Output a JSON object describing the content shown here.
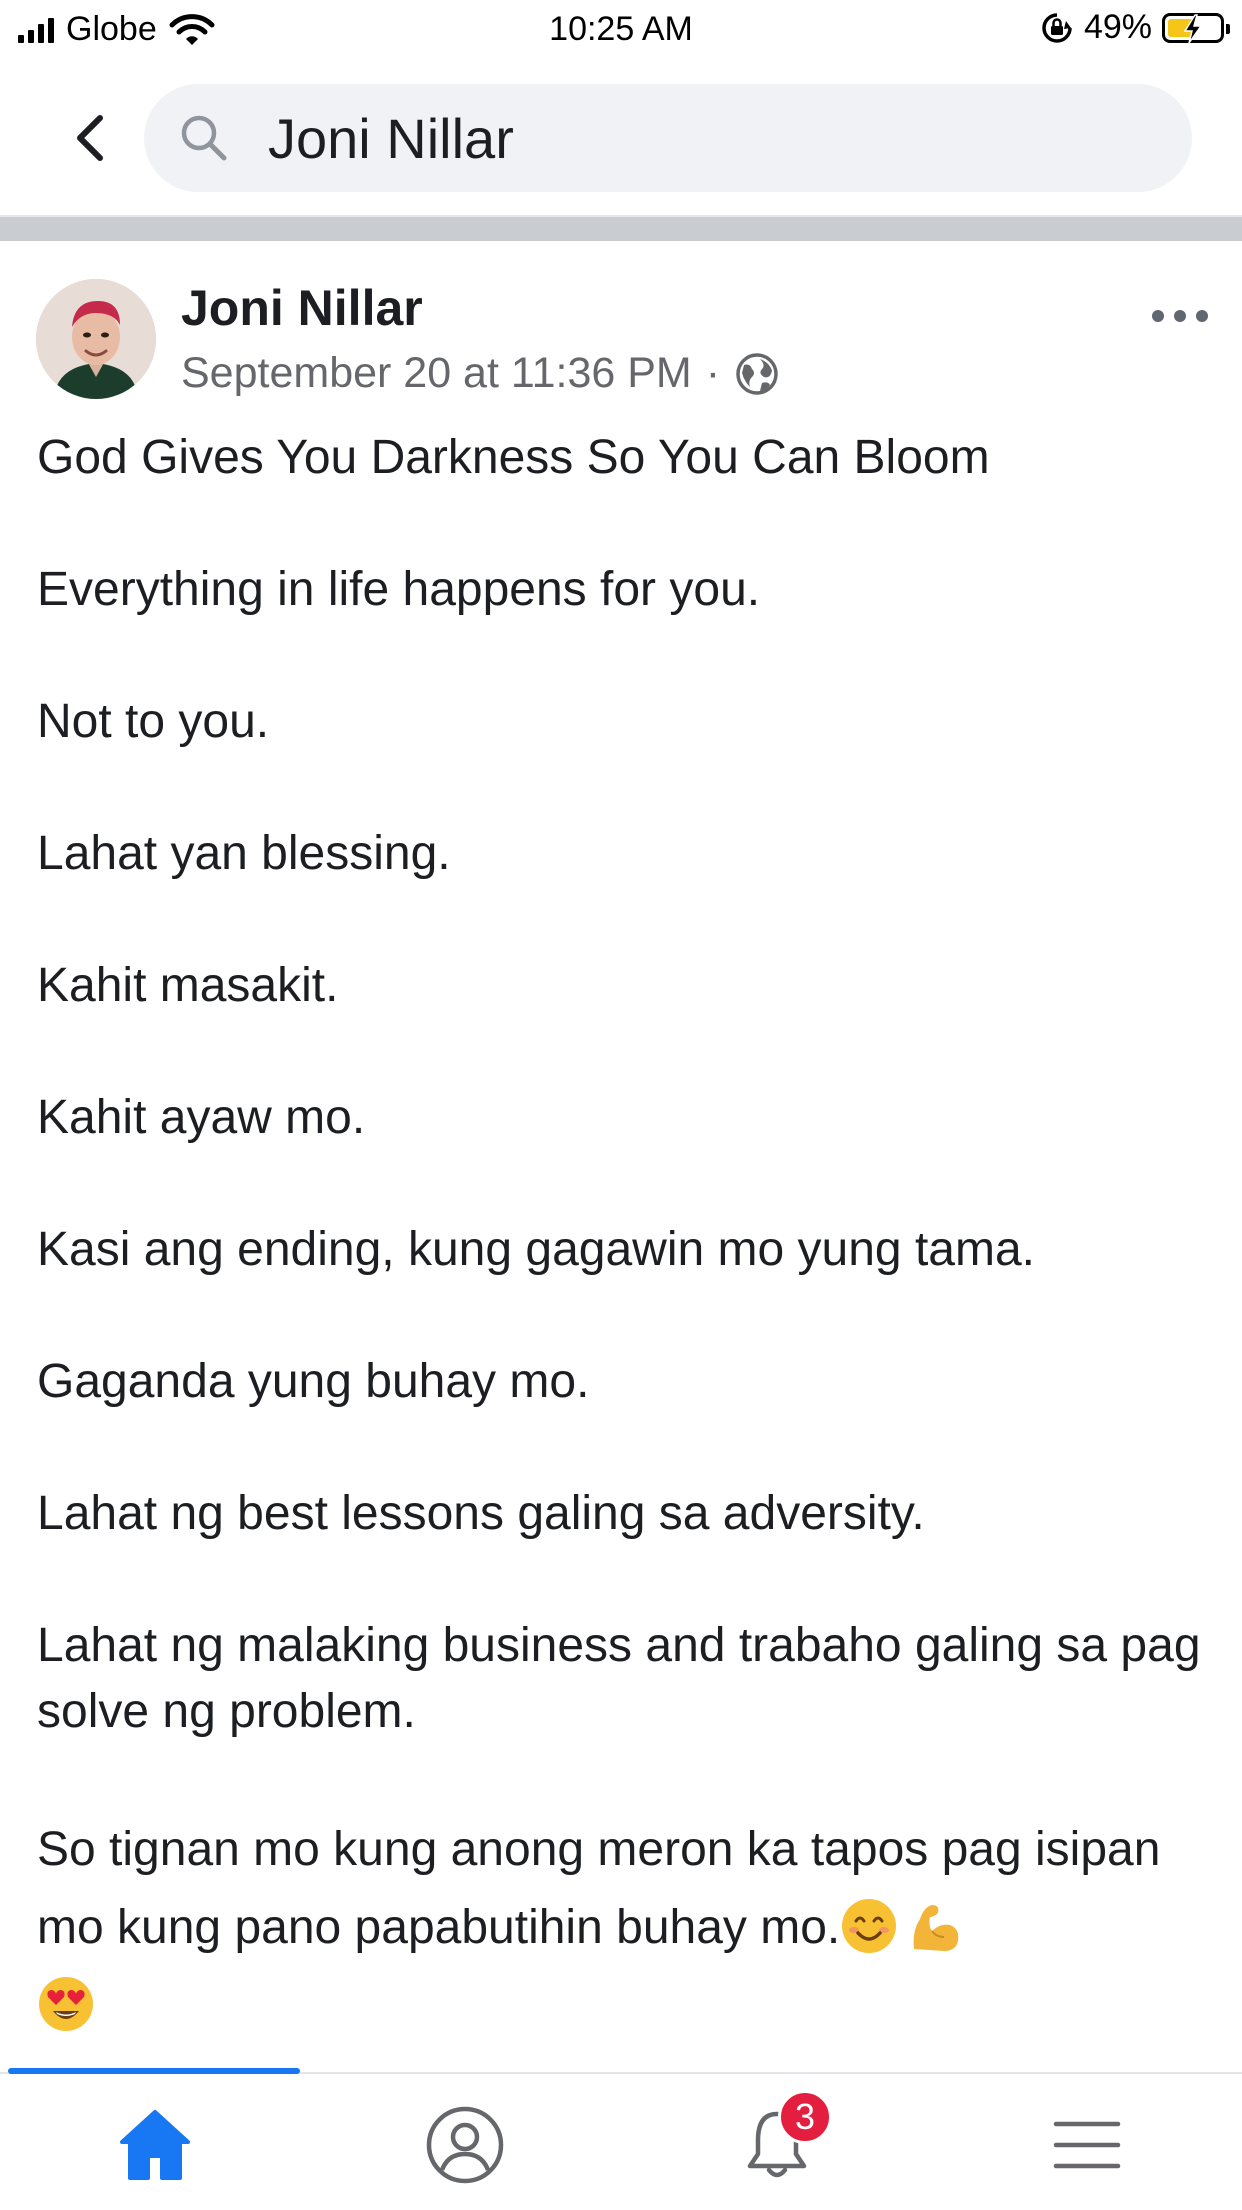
{
  "status_bar": {
    "carrier": "Globe",
    "time": "10:25 AM",
    "battery_percent": "49%",
    "battery_level": 0.49,
    "icons": [
      "signal-icon",
      "wifi-icon",
      "orientation-lock-icon",
      "battery-charging-icon"
    ]
  },
  "search": {
    "query": "Joni Nillar",
    "icons": [
      "back-icon",
      "search-icon"
    ]
  },
  "post": {
    "author": "Joni Nillar",
    "timestamp": "September 20 at 11:36 PM",
    "separator": "·",
    "privacy_icon": "globe-icon",
    "paragraphs": [
      "God Gives You Darkness So You Can Bloom",
      "Everything in life happens for you.",
      "Not to you.",
      "Lahat yan blessing.",
      "Kahit masakit.",
      "Kahit ayaw mo.",
      "Kasi ang ending, kung gagawin mo yung tama.",
      "Gaganda yung buhay mo.",
      "Lahat ng best lessons galing sa adversity.",
      "Lahat ng malaking business and trabaho galing sa pag solve ng problem.",
      "So tignan mo kung anong meron ka tapos pag isipan mo kung pano papabutihin buhay mo."
    ],
    "trailing_emojis": [
      "smiling-face-emoji",
      "flexed-biceps-emoji",
      "heart-eyes-emoji"
    ]
  },
  "bottom_nav": {
    "items": [
      "home-icon",
      "profile-icon",
      "notifications-icon",
      "menu-icon"
    ],
    "notification_count": "3",
    "active_color": "#1877f2",
    "badge_color": "#e41e3f"
  }
}
